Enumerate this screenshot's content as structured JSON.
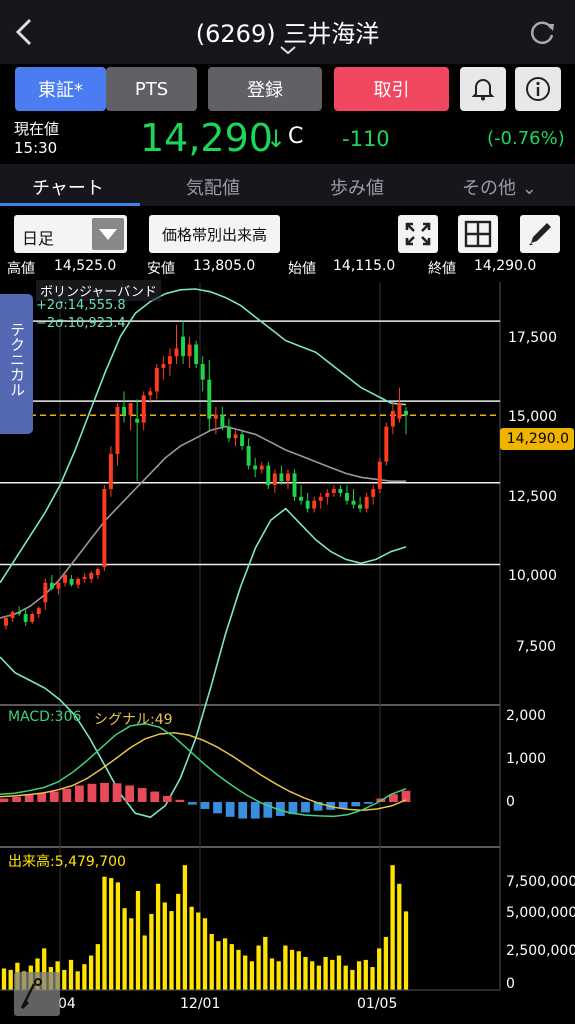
{
  "header": {
    "title": "(6269) 三井海洋"
  },
  "buttons": {
    "tosho": "東証*",
    "pts": "PTS",
    "register": "登録",
    "trade": "取引"
  },
  "quote": {
    "now_label": "現在値",
    "time": "15:30",
    "price": "14,290",
    "arrow": "↓",
    "c_tag": "C",
    "change": "-110",
    "change_pct": "(-0.76%)"
  },
  "tabs": [
    "チャート",
    "気配値",
    "歩み値",
    "その他 ⌄"
  ],
  "toolbar": {
    "period": "日足",
    "volume_profile": "価格帯別出来高"
  },
  "ohlc": {
    "high_label": "高値",
    "high": "14,525.0",
    "low_label": "安値",
    "low": "13,805.0",
    "open_label": "始値",
    "open": "14,115.0",
    "close_label": "終値",
    "close": "14,290.0"
  },
  "indicator": {
    "bb_name": "ボリンジャーバンド",
    "bb_upper": "+2σ:14,555.8",
    "bb_lower": "−2σ:10,923.4",
    "technical_tab": "テクニカル",
    "current_price_tag": "14,290.0"
  },
  "macd": {
    "label": "MACD:306",
    "signal": "シグナル:49"
  },
  "volume": {
    "label": "出来高:5,479,700"
  },
  "axes": {
    "price_ticks": [
      "17,500",
      "15,000",
      "12,500",
      "10,000",
      "7,500"
    ],
    "macd_ticks": [
      "2,000",
      "1,000",
      "0"
    ],
    "volume_ticks": [
      "7,500,000",
      "5,000,000",
      "2,500,000",
      "0"
    ],
    "x_ticks": [
      "04",
      "12/01",
      "01/05"
    ]
  },
  "colors": {
    "up": "#ff3b1f",
    "down": "#21d24a",
    "bb": "#7ee6c8",
    "ma": "#9a9a9a",
    "macd": "#3fd27a",
    "signal": "#e8c24a",
    "hist_pos": "#e84a5a",
    "hist_neg": "#3a8ee0",
    "volume": "#ffe400",
    "accent": "#f0b400"
  },
  "chart_data": {
    "type": "line",
    "x_ticks": [
      "04",
      "12/01",
      "01/05"
    ],
    "ylim_price": [
      7000,
      17700
    ],
    "candles": [
      [
        8900,
        9150,
        8800,
        9100
      ],
      [
        9100,
        9300,
        9000,
        9250
      ],
      [
        9250,
        9400,
        9150,
        9200
      ],
      [
        9200,
        9350,
        8900,
        9000
      ],
      [
        9000,
        9250,
        8950,
        9200
      ],
      [
        9200,
        9400,
        9100,
        9350
      ],
      [
        9500,
        10100,
        9300,
        10000
      ],
      [
        10000,
        10200,
        9800,
        9850
      ],
      [
        9850,
        10100,
        9700,
        10000
      ],
      [
        10000,
        10250,
        9900,
        10200
      ],
      [
        10100,
        10200,
        9900,
        9950
      ],
      [
        9950,
        10150,
        9850,
        10100
      ],
      [
        10100,
        10250,
        10000,
        10150
      ],
      [
        10100,
        10300,
        10000,
        10250
      ],
      [
        10200,
        10400,
        10100,
        10350
      ],
      [
        10400,
        12500,
        10300,
        12400
      ],
      [
        12400,
        13500,
        12200,
        13300
      ],
      [
        13300,
        14600,
        13000,
        14500
      ],
      [
        14500,
        14900,
        14100,
        14300
      ],
      [
        14300,
        14600,
        13900,
        14600
      ],
      [
        14200,
        14700,
        12600,
        14100
      ],
      [
        14100,
        14900,
        13900,
        14800
      ],
      [
        14800,
        15000,
        14600,
        14900
      ],
      [
        14900,
        15600,
        14700,
        15500
      ],
      [
        15500,
        15800,
        15200,
        15600
      ],
      [
        15600,
        16000,
        15300,
        15800
      ],
      [
        15800,
        16600,
        15600,
        16000
      ],
      [
        16300,
        16700,
        15600,
        15800
      ],
      [
        15800,
        16300,
        15500,
        16100
      ],
      [
        16100,
        16200,
        15500,
        15600
      ],
      [
        15600,
        15800,
        14900,
        15200
      ],
      [
        15200,
        15700,
        13900,
        14200
      ],
      [
        14200,
        14500,
        13800,
        14300
      ],
      [
        14300,
        14500,
        13900,
        14000
      ],
      [
        14000,
        14200,
        13600,
        13700
      ],
      [
        13700,
        13900,
        13500,
        13800
      ],
      [
        13800,
        13900,
        13400,
        13500
      ],
      [
        13500,
        13700,
        12900,
        13000
      ],
      [
        13000,
        13200,
        12700,
        12900
      ],
      [
        12900,
        13100,
        12800,
        13000
      ],
      [
        13000,
        13100,
        12400,
        12500
      ],
      [
        12500,
        12900,
        12300,
        12800
      ],
      [
        12800,
        13000,
        12500,
        12600
      ],
      [
        12600,
        12900,
        12400,
        12800
      ],
      [
        12800,
        12900,
        12100,
        12200
      ],
      [
        12200,
        12500,
        12000,
        12100
      ],
      [
        12100,
        12300,
        11800,
        11900
      ],
      [
        11900,
        12200,
        11800,
        12100
      ],
      [
        12100,
        12300,
        11900,
        12200
      ],
      [
        12200,
        12400,
        12000,
        12300
      ],
      [
        12300,
        12500,
        12200,
        12400
      ],
      [
        12400,
        12500,
        12200,
        12300
      ],
      [
        12300,
        12500,
        12000,
        12100
      ],
      [
        12100,
        12400,
        11900,
        12000
      ],
      [
        12000,
        12200,
        11800,
        11900
      ],
      [
        11900,
        12300,
        11800,
        12200
      ],
      [
        12200,
        12500,
        12000,
        12400
      ],
      [
        12400,
        13200,
        12300,
        13100
      ],
      [
        13100,
        14100,
        13000,
        14000
      ],
      [
        14000,
        14600,
        13800,
        14400
      ],
      [
        14200,
        15000,
        14100,
        14600
      ],
      [
        14400,
        14500,
        13800,
        14290
      ]
    ],
    "bb_upper": [
      10000,
      10600,
      11200,
      11800,
      12500,
      13400,
      14400,
      15400,
      16300,
      16900,
      17200,
      17400,
      17500,
      17520,
      17450,
      17300,
      17100,
      16800,
      16500,
      16200,
      16050,
      15900,
      15600,
      15300,
      15000,
      14800,
      14600,
      14560
    ],
    "bb_lower": [
      8100,
      7700,
      7500,
      7300,
      7000,
      6600,
      6000,
      5300,
      4600,
      4100,
      4000,
      4300,
      5000,
      6000,
      7300,
      8700,
      9900,
      10900,
      11600,
      11900,
      11500,
      11100,
      10800,
      10600,
      10500,
      10600,
      10800,
      10920
    ],
    "ma": [
      9100,
      9200,
      9400,
      9700,
      10100,
      10600,
      11100,
      11600,
      12000,
      12400,
      12800,
      13200,
      13500,
      13700,
      13900,
      14000,
      13900,
      13800,
      13600,
      13400,
      13250,
      13100,
      12950,
      12800,
      12700,
      12650,
      12600,
      12600
    ],
    "macd_line": [
      180,
      200,
      260,
      330,
      460,
      680,
      950,
      1250,
      1550,
      1750,
      1800,
      1720,
      1500,
      1200,
      900,
      620,
      380,
      160,
      -20,
      -150,
      -250,
      -300,
      -320,
      -330,
      -290,
      -180,
      -20,
      180,
      306
    ],
    "signal_line": [
      120,
      140,
      170,
      210,
      280,
      380,
      540,
      760,
      1000,
      1250,
      1450,
      1560,
      1590,
      1540,
      1420,
      1260,
      1060,
      840,
      620,
      420,
      240,
      90,
      -30,
      -120,
      -170,
      -190,
      -160,
      -90,
      49
    ],
    "histogram": [
      80,
      120,
      160,
      200,
      240,
      300,
      380,
      420,
      440,
      430,
      380,
      320,
      240,
      140,
      50,
      -60,
      -160,
      -260,
      -340,
      -380,
      -380,
      -360,
      -320,
      -280,
      -240,
      -200,
      -180,
      -150,
      -100,
      -40,
      80,
      180,
      260
    ],
    "volume": [
      1500000,
      1400000,
      1900000,
      1300000,
      1700000,
      2200000,
      2900000,
      1600000,
      2000000,
      1400000,
      2100000,
      1300000,
      1800000,
      2400000,
      3200000,
      7900000,
      7800000,
      7500000,
      5700000,
      5000000,
      6900000,
      3800000,
      5300000,
      7400000,
      6100000,
      5500000,
      6700000,
      8700000,
      5800000,
      5400000,
      5000000,
      3900000,
      3400000,
      3600000,
      3200000,
      2800000,
      2400000,
      2000000,
      3100000,
      3700000,
      2200000,
      2000000,
      3100000,
      2800000,
      2700000,
      2300000,
      2000000,
      1700000,
      2300000,
      2100000,
      2400000,
      1700000,
      1400000,
      2000000,
      2100000,
      1600000,
      2900000,
      3700000,
      8700000,
      7400000,
      5480000
    ]
  }
}
